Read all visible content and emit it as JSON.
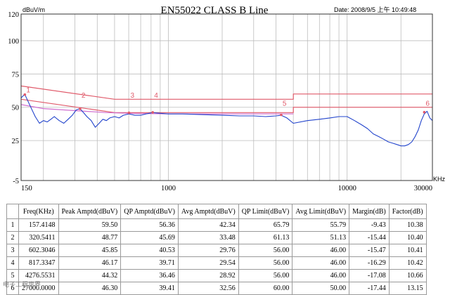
{
  "chart_data": {
    "type": "line",
    "title": "EN55022 CLASS B   Line",
    "date_label": "Date: 2008/9/5 上午 10:49:48",
    "ylabel": "dBuV/m",
    "xunit": "KHz",
    "xscale": "log",
    "xlim": [
      150,
      30000
    ],
    "ylim": [
      -5,
      120
    ],
    "y_ticks": [
      -5,
      20,
      50,
      100,
      120
    ],
    "y_tick_labels": [
      "-5",
      "25",
      "50",
      "75",
      "100",
      "120"
    ],
    "y_tick_values": [
      -5,
      25,
      50,
      75,
      100,
      120
    ],
    "x_tick_labels": [
      "150",
      "1000",
      "10000",
      "30000"
    ],
    "x_tick_values": [
      150,
      1000,
      10000,
      30000
    ],
    "grid": true,
    "series": [
      {
        "color": "#e05a6a",
        "style": "limit-qp",
        "x": [
          150,
          500,
          500,
          5000,
          5000,
          30000
        ],
        "y": [
          66,
          56,
          56,
          56,
          60,
          60
        ]
      },
      {
        "color": "#e05a6a",
        "style": "limit-avg",
        "x": [
          150,
          500,
          500,
          5000,
          5000,
          30000
        ],
        "y": [
          56,
          46,
          46,
          46,
          50,
          50
        ]
      },
      {
        "color": "#d070d0",
        "style": "reference",
        "x": [
          150,
          200,
          300,
          450,
          600,
          800,
          1000,
          2000,
          4000,
          5000
        ],
        "y": [
          52,
          49,
          47.5,
          46,
          45.5,
          45.2,
          45,
          45,
          45,
          45
        ]
      },
      {
        "color": "#2244cc",
        "style": "measurement",
        "x": [
          150,
          155,
          157,
          162,
          170,
          180,
          190,
          200,
          210,
          220,
          230,
          245,
          260,
          275,
          290,
          305,
          320,
          335,
          350,
          370,
          390,
          410,
          430,
          450,
          470,
          500,
          530,
          560,
          600,
          650,
          700,
          750,
          817,
          900,
          1000,
          1200,
          1500,
          2000,
          2500,
          3000,
          3500,
          4000,
          4276,
          4600,
          5000,
          6000,
          7000,
          8000,
          9000,
          10000,
          11000,
          12000,
          13000,
          14000,
          15000,
          16000,
          17000,
          18000,
          19000,
          20000,
          21000,
          22000,
          23000,
          24000,
          25000,
          26000,
          27000,
          28000,
          29000,
          30000
        ],
        "y": [
          57,
          59,
          60,
          56,
          50,
          43,
          38,
          40,
          39,
          41,
          43,
          40,
          38,
          41,
          44,
          48,
          49,
          46,
          43,
          40,
          35,
          38,
          41,
          40,
          42,
          43,
          42,
          44,
          45,
          44,
          44,
          45,
          46,
          45.5,
          45,
          45,
          44.5,
          44,
          43.5,
          43.5,
          43,
          43.5,
          44,
          42,
          38,
          40,
          41,
          42,
          43,
          43,
          40,
          37,
          34,
          30,
          28,
          26,
          24,
          23,
          22,
          21,
          21,
          22,
          24,
          28,
          33,
          40,
          45,
          47,
          42,
          40
        ]
      }
    ],
    "markers": [
      {
        "label": "1",
        "x": 157.4148,
        "y": 59.5
      },
      {
        "label": "2",
        "x": 320.5411,
        "y": 48.77
      },
      {
        "label": "3",
        "x": 602.3046,
        "y": 45.85
      },
      {
        "label": "4",
        "x": 817.3347,
        "y": 46.17
      },
      {
        "label": "5",
        "x": 4276.5531,
        "y": 44.32
      },
      {
        "label": "6",
        "x": 27000,
        "y": 46.3
      }
    ]
  },
  "table": {
    "headers": [
      "Freq(KHz)",
      "Peak Amptd(dBuV)",
      "QP Amptd(dBuV)",
      "Avg Amptd(dBuV)",
      "QP Limit(dBuV)",
      "Avg Limit(dBuV)",
      "Margin(dB)",
      "Factor(dB)"
    ],
    "rows": [
      {
        "idx": "1",
        "cells": [
          "157.4148",
          "59.50",
          "56.36",
          "42.34",
          "65.79",
          "55.79",
          "-9.43",
          "10.38"
        ]
      },
      {
        "idx": "2",
        "cells": [
          "320.5411",
          "48.77",
          "45.69",
          "33.48",
          "61.13",
          "51.13",
          "-15.44",
          "10.40"
        ]
      },
      {
        "idx": "3",
        "cells": [
          "602.3046",
          "45.85",
          "40.53",
          "29.76",
          "56.00",
          "46.00",
          "-15.47",
          "10.41"
        ]
      },
      {
        "idx": "4",
        "cells": [
          "817.3347",
          "46.17",
          "39.71",
          "29.54",
          "56.00",
          "46.00",
          "-16.29",
          "10.42"
        ]
      },
      {
        "idx": "5",
        "cells": [
          "4276.5531",
          "44.32",
          "36.46",
          "28.92",
          "56.00",
          "46.00",
          "-17.08",
          "10.66"
        ]
      },
      {
        "idx": "6",
        "cells": [
          "27000.0000",
          "46.30",
          "39.41",
          "32.56",
          "60.00",
          "50.00",
          "-17.44",
          "13.15"
        ]
      }
    ]
  },
  "watermark": "电子工程世界"
}
